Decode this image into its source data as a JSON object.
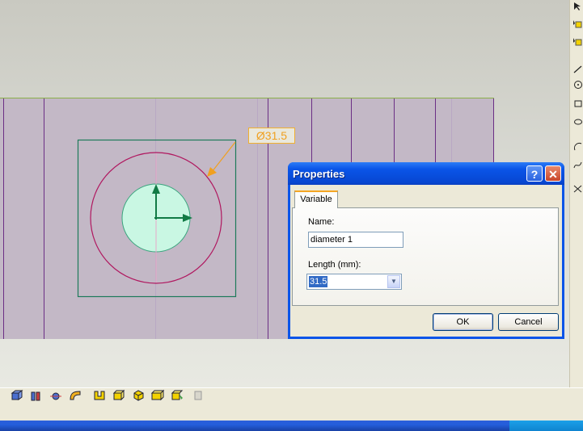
{
  "viewport": {
    "dimension_label": "Ø31.5"
  },
  "dialog": {
    "title": "Properties",
    "help_glyph": "?",
    "close_glyph": "✕",
    "tabs": [
      {
        "label": "Variable",
        "active": true
      }
    ],
    "name_label": "Name:",
    "name_value": "diameter 1",
    "length_label": "Length (mm):",
    "length_value": "31.5",
    "ok_label": "OK",
    "cancel_label": "Cancel"
  },
  "toolbar_right": {
    "icons": [
      "select-icon",
      "select-filter-icon",
      "multi-select-icon",
      "line-icon",
      "circle-icon",
      "rectangle-icon",
      "ellipse-icon",
      "arc-icon",
      "spline-icon",
      "trim-icon"
    ]
  },
  "toolbar_bottom": {
    "icons": [
      "extrude-icon",
      "revolve-icon",
      "sweep-icon",
      "loft-icon",
      "shell-icon",
      "box-icon",
      "cylinder-icon",
      "block-icon",
      "fillet-icon",
      "chamfer-icon"
    ]
  },
  "colors": {
    "sketch_circle": "#b0175f",
    "hole_fill": "#c9f7e3",
    "sketch_box": "#1d7a5a",
    "dimension": "#f0a020",
    "titlebar": "#0a55e8"
  }
}
